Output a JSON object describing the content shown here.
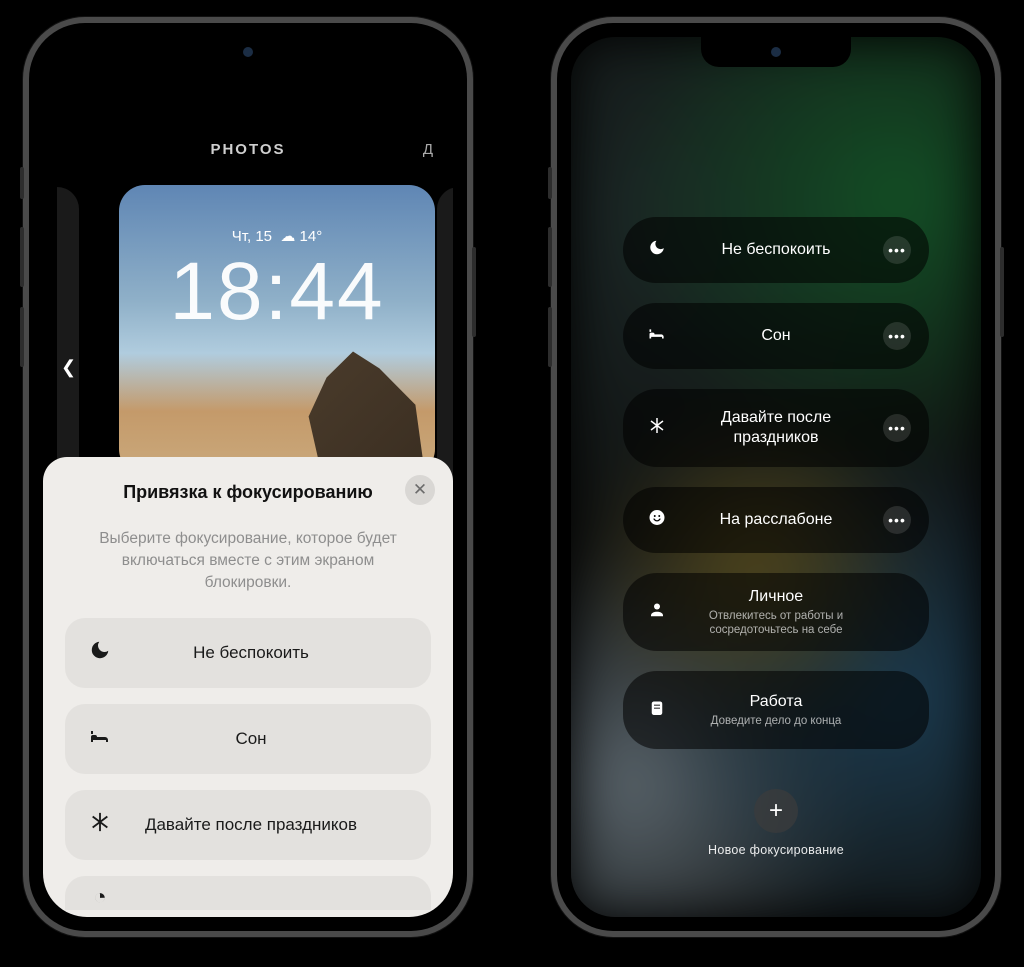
{
  "left": {
    "header_label": "PHOTOS",
    "header_next": "Д",
    "wallpaper": {
      "date": "Чт, 15",
      "weather_icon": "☁",
      "temp": "14°",
      "time": "18:44"
    },
    "sheet": {
      "title": "Привязка к фокусированию",
      "subtitle": "Выберите фокусирование, которое будет включаться вместе с этим экраном блокировки.",
      "close_glyph": "✕",
      "items": [
        {
          "icon": "🌙",
          "label": "Не беспокоить"
        },
        {
          "icon": "🛏",
          "label": "Сон"
        },
        {
          "icon": "❄",
          "label": "Давайте после праздников"
        }
      ]
    }
  },
  "right": {
    "items": [
      {
        "icon": "🌙",
        "title": "Не беспокоить",
        "has_more": true
      },
      {
        "icon": "🛏",
        "title": "Сон",
        "has_more": true
      },
      {
        "icon": "❄",
        "title": "Давайте после праздников",
        "has_more": true
      },
      {
        "icon": "😀",
        "title": "На расслабоне",
        "has_more": true
      },
      {
        "icon": "👤",
        "title": "Личное",
        "sub": "Отвлекитесь от работы и сосредоточьтесь на себе"
      },
      {
        "icon": "🪪",
        "title": "Работа",
        "sub": "Доведите дело до конца"
      }
    ],
    "add_label": "Новое фокусирование",
    "add_glyph": "+"
  }
}
